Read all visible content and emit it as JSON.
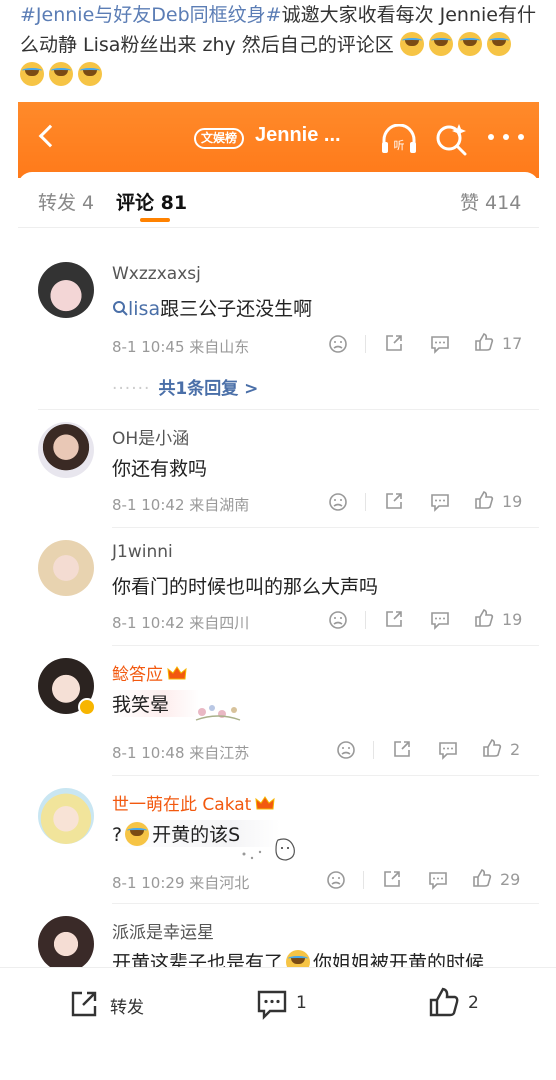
{
  "post": {
    "tag": "#Jennie与好友Deb同框纹身#",
    "text": "诚邀大家收看每次 Jennie有什么动静 Lisa粉丝出来 zhy 然后自己的评论区",
    "emoji": "laugh-cry-emoji"
  },
  "header": {
    "badge": "文娱榜",
    "title": "Jennie ..."
  },
  "tabs": {
    "repost": "转发 4",
    "comments": "评论 81",
    "likes": "赞 414"
  },
  "comments": [
    {
      "user": "Wxzzxaxsj",
      "search_icon": "search-icon",
      "search_term": "lisa",
      "text": "跟三公子还没生啊",
      "meta": "8-1 10:45  来自山东",
      "likes": "17",
      "replies": "共1条回复 >"
    },
    {
      "user": "OH是小涵",
      "text": "你还有救吗",
      "meta": "8-1 10:42  来自湖南",
      "likes": "19"
    },
    {
      "user": "J1winni",
      "text": "你看门的时候也叫的那么大声吗",
      "meta": "8-1 10:42  来自四川",
      "likes": "19"
    },
    {
      "user": "鲶答应",
      "text": "我笑晕",
      "meta": "8-1 10:48  来自江苏",
      "likes": "2"
    },
    {
      "user": "世一萌在此 Cakat",
      "text": "开黄的该S",
      "prefix": "?",
      "meta": "8-1 10:29  来自河北",
      "likes": "29"
    },
    {
      "user": "派派是幸运星",
      "text": "开黄这辈子也是有了",
      "text_tail": "你姐姐被开黄的时候"
    }
  ],
  "bottom": {
    "repost": "转发",
    "comments": "1",
    "likes": "2"
  },
  "colors": {
    "brand_orange": "#ff8200",
    "link_blue": "#4a6fa8",
    "vip_orange": "#f2590f"
  }
}
